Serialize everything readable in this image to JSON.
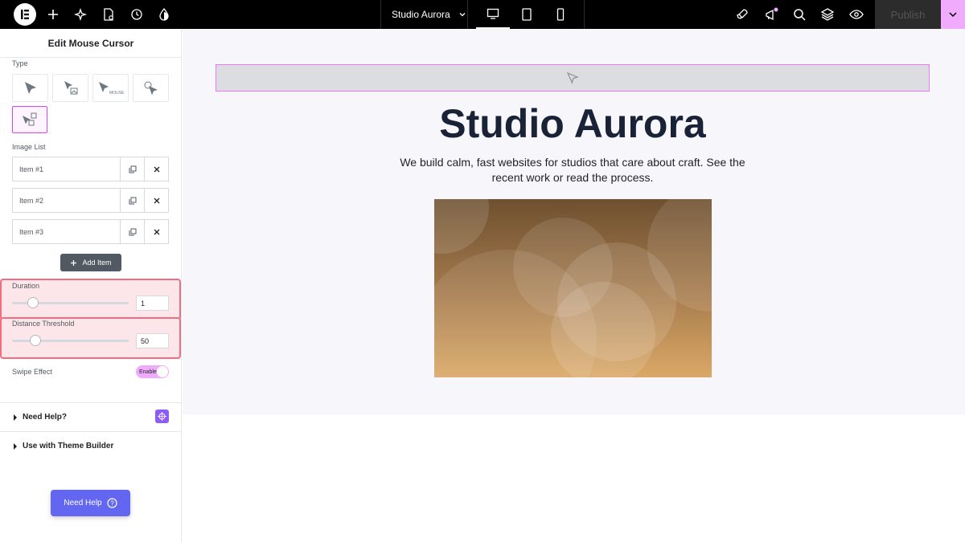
{
  "topbar": {
    "site_name": "Studio Aurora",
    "publish_label": "Publish",
    "icons": [
      "elementor-logo-icon",
      "plus-icon",
      "sparkle-icon",
      "page-settings-icon",
      "history-icon",
      "theme-style-icon",
      "rocket-icon",
      "whats-new-icon",
      "search-icon",
      "layers-icon",
      "preview-eye-icon"
    ],
    "devices": [
      "desktop-icon",
      "tablet-icon",
      "mobile-icon"
    ],
    "active_device": "desktop"
  },
  "panel": {
    "title": "Edit Mouse Cursor",
    "type_label": "Type",
    "type_options": [
      {
        "name": "cursor-default-option"
      },
      {
        "name": "cursor-image-option"
      },
      {
        "name": "cursor-text-option",
        "text": "MOUSE"
      },
      {
        "name": "cursor-custom-option"
      },
      {
        "name": "cursor-image-list-option",
        "selected": true
      }
    ],
    "image_list_label": "Image List",
    "items": [
      {
        "label": "Item #1"
      },
      {
        "label": "Item #2"
      },
      {
        "label": "Item #3"
      }
    ],
    "add_item_label": "Add Item",
    "duration": {
      "label": "Duration",
      "value": "1",
      "slider_fraction": 0.18
    },
    "distance": {
      "label": "Distance Threshold",
      "value": "50",
      "slider_fraction": 0.2
    },
    "swipe": {
      "label": "Swipe Effect",
      "toggle_text": "Enable",
      "enabled": true
    },
    "need_help_section": "Need Help?",
    "theme_builder_section": "Use with Theme Builder",
    "need_help_button": "Need Help"
  },
  "canvas": {
    "title": "Studio Aurora",
    "subtitle": "We build calm, fast websites for studios that care about craft. See the recent work or read the process."
  },
  "colors": {
    "accent_pink": "#f0abfc",
    "selection_border": "#d946ef",
    "highlight_red": "#f26d7d",
    "help_button": "#6366f1",
    "title_navy": "#1a2238"
  }
}
